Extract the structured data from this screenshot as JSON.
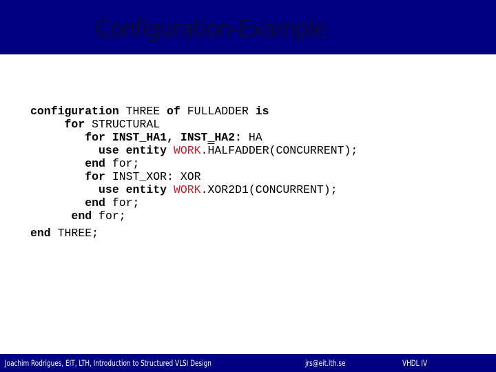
{
  "slide": {
    "title": "Configuration-Example",
    "colors": {
      "header_bg": "#000080",
      "footer_bg": "#000080",
      "title_text": "#0a0a3a",
      "library_name": "#c0202a"
    },
    "code": {
      "lines": [
        {
          "parts": [
            {
              "t": "configuration",
              "s": "kw"
            },
            {
              "t": " THREE ",
              "s": ""
            },
            {
              "t": "of",
              "s": "kw"
            },
            {
              "t": " FULLADDER ",
              "s": ""
            },
            {
              "t": "is",
              "s": "kw"
            }
          ]
        },
        {
          "parts": [
            {
              "t": "     ",
              "s": ""
            },
            {
              "t": "for",
              "s": "kw"
            },
            {
              "t": " STRUCTURAL",
              "s": ""
            }
          ]
        },
        {
          "parts": [
            {
              "t": "        ",
              "s": ""
            },
            {
              "t": "for INST_HA1, INST_HA2:",
              "s": "kw"
            },
            {
              "t": " HA",
              "s": ""
            }
          ]
        },
        {
          "parts": [
            {
              "t": "          ",
              "s": ""
            },
            {
              "t": "use entity",
              "s": "kw"
            },
            {
              "t": " ",
              "s": ""
            },
            {
              "t": "WORK",
              "s": "lib"
            },
            {
              "t": ".",
              "s": ""
            },
            {
              "t": "H",
              "s": "ovl"
            },
            {
              "t": "ALFADDER(CONCURRENT);",
              "s": ""
            }
          ]
        },
        {
          "parts": [
            {
              "t": "        ",
              "s": ""
            },
            {
              "t": "end",
              "s": "kw"
            },
            {
              "t": " for;",
              "s": ""
            }
          ]
        },
        {
          "parts": [
            {
              "t": "        ",
              "s": ""
            },
            {
              "t": "for",
              "s": "kw"
            },
            {
              "t": " INST_XOR: XOR",
              "s": ""
            }
          ]
        },
        {
          "parts": [
            {
              "t": "          ",
              "s": ""
            },
            {
              "t": "use entity",
              "s": "kw"
            },
            {
              "t": " ",
              "s": ""
            },
            {
              "t": "WORK",
              "s": "lib"
            },
            {
              "t": ".XOR2D1(CONCURRENT);",
              "s": ""
            }
          ]
        },
        {
          "parts": [
            {
              "t": "        ",
              "s": ""
            },
            {
              "t": "end",
              "s": "kw"
            },
            {
              "t": " for;",
              "s": ""
            }
          ]
        },
        {
          "parts": [
            {
              "t": "      ",
              "s": ""
            },
            {
              "t": "end",
              "s": "kw"
            },
            {
              "t": " for;",
              "s": ""
            }
          ]
        },
        {
          "parts": [
            {
              "t": "end",
              "s": "kw"
            },
            {
              "t": " THREE;",
              "s": ""
            }
          ]
        }
      ]
    },
    "footer": {
      "author": "Joachim Rodrigues, EIT, LTH, Introduction to Structured VLSI Design",
      "email": "jrs@eit.lth.se",
      "course": "VHDL IV"
    }
  }
}
